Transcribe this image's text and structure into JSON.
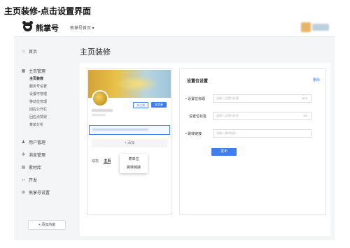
{
  "caption": "主页装修-点击设置界面",
  "topbar": {
    "logo_text": "熊掌号",
    "account_switch": "熊掌号首页 ▾"
  },
  "sidebar": {
    "items": [
      {
        "icon": "home-icon",
        "label": "首页"
      },
      {
        "icon": "grid-icon",
        "label": "主页管理"
      },
      {
        "icon": "user-icon",
        "label": "用户管理"
      },
      {
        "icon": "gear-icon",
        "label": "消息管理"
      },
      {
        "icon": "folder-icon",
        "label": "素材库"
      },
      {
        "icon": "code-icon",
        "label": "开发"
      },
      {
        "icon": "settings-icon",
        "label": "熊掌号设置"
      }
    ],
    "sub_items": [
      "主页装修",
      "服务号设置",
      "设置可管理",
      "移动位管理",
      "回应公开栏",
      "回应点赞收",
      "菜单分析"
    ],
    "add_function": "+  添加功能"
  },
  "main": {
    "page_title": "主页装修",
    "preview": {
      "follow_button": "关注我",
      "message_button": "发消息",
      "add_menu": "+ 添加",
      "tabs": [
        "动态",
        "主页"
      ],
      "dropdown": [
        "菜单位",
        "跳转链接"
      ]
    },
    "settings": {
      "title": "设置位设置",
      "delete": "删除",
      "fields": [
        {
          "label": "• 设置位标题",
          "placeholder": "请输入设置位标题",
          "count": "0/15"
        },
        {
          "label": "设置位标签",
          "placeholder": "请输入设置位标签",
          "count": "0/4"
        },
        {
          "label": "• 跳转链接",
          "placeholder": "请输入跳转链接",
          "count": ""
        }
      ],
      "publish": "发布"
    }
  }
}
